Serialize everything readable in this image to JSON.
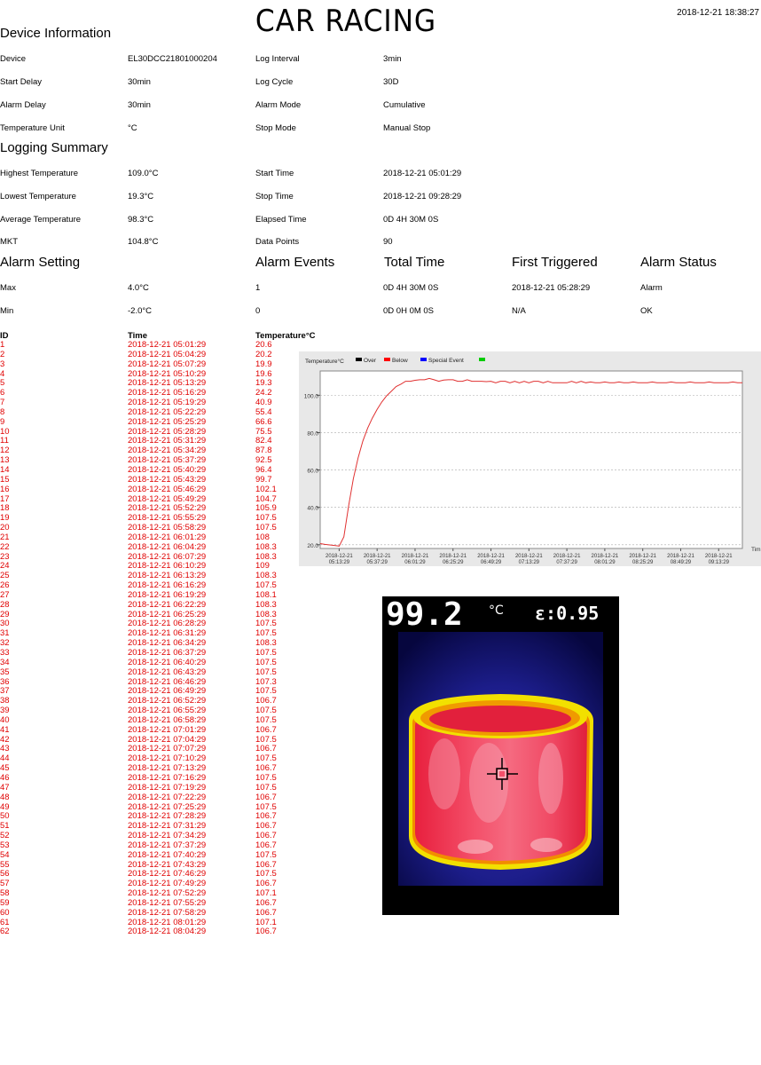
{
  "header": {
    "title": "CAR RACING",
    "timestamp": "2018-12-21 18:38:27"
  },
  "device_info": {
    "heading": "Device Information",
    "left": [
      {
        "label": "Device",
        "value": "EL30DCC21801000204"
      },
      {
        "label": "Start Delay",
        "value": "30min"
      },
      {
        "label": "Alarm Delay",
        "value": "30min"
      },
      {
        "label": "Temperature Unit",
        "value": "°C"
      }
    ],
    "right": [
      {
        "label": "Log Interval",
        "value": "3min"
      },
      {
        "label": "Log Cycle",
        "value": "30D"
      },
      {
        "label": "Alarm Mode",
        "value": "Cumulative"
      },
      {
        "label": "Stop Mode",
        "value": "Manual Stop"
      }
    ]
  },
  "summary": {
    "heading": "Logging Summary",
    "left": [
      {
        "label": "Highest Temperature",
        "value": "109.0°C"
      },
      {
        "label": "Lowest Temperature",
        "value": "19.3°C"
      },
      {
        "label": "Average Temperature",
        "value": "98.3°C"
      },
      {
        "label": "MKT",
        "value": "104.8°C"
      }
    ],
    "right": [
      {
        "label": "Start Time",
        "value": "2018-12-21 05:01:29"
      },
      {
        "label": "Stop Time",
        "value": "2018-12-21 09:28:29"
      },
      {
        "label": "Elapsed Time",
        "value": "0D 4H 30M 0S"
      },
      {
        "label": "Data Points",
        "value": "90"
      }
    ]
  },
  "alarm": {
    "headings": [
      "Alarm Setting",
      "Alarm Events",
      "Total Time",
      "First Triggered",
      "Alarm Status"
    ],
    "rows": [
      [
        "Max",
        "4.0°C",
        "1",
        "0D 4H 30M 0S",
        "2018-12-21 05:28:29",
        "Alarm"
      ],
      [
        "Min",
        "-2.0°C",
        "0",
        "0D 0H 0M 0S",
        "N/A",
        "OK"
      ]
    ]
  },
  "table": {
    "headers": [
      "ID",
      "Time",
      "Temperature°C"
    ],
    "rows": [
      [
        "1",
        "2018-12-21 05:01:29",
        "20.6"
      ],
      [
        "2",
        "2018-12-21 05:04:29",
        "20.2"
      ],
      [
        "3",
        "2018-12-21 05:07:29",
        "19.9"
      ],
      [
        "4",
        "2018-12-21 05:10:29",
        "19.6"
      ],
      [
        "5",
        "2018-12-21 05:13:29",
        "19.3"
      ],
      [
        "6",
        "2018-12-21 05:16:29",
        "24.2"
      ],
      [
        "7",
        "2018-12-21 05:19:29",
        "40.9"
      ],
      [
        "8",
        "2018-12-21 05:22:29",
        "55.4"
      ],
      [
        "9",
        "2018-12-21 05:25:29",
        "66.6"
      ],
      [
        "10",
        "2018-12-21 05:28:29",
        "75.5"
      ],
      [
        "11",
        "2018-12-21 05:31:29",
        "82.4"
      ],
      [
        "12",
        "2018-12-21 05:34:29",
        "87.8"
      ],
      [
        "13",
        "2018-12-21 05:37:29",
        "92.5"
      ],
      [
        "14",
        "2018-12-21 05:40:29",
        "96.4"
      ],
      [
        "15",
        "2018-12-21 05:43:29",
        "99.7"
      ],
      [
        "16",
        "2018-12-21 05:46:29",
        "102.1"
      ],
      [
        "17",
        "2018-12-21 05:49:29",
        "104.7"
      ],
      [
        "18",
        "2018-12-21 05:52:29",
        "105.9"
      ],
      [
        "19",
        "2018-12-21 05:55:29",
        "107.5"
      ],
      [
        "20",
        "2018-12-21 05:58:29",
        "107.5"
      ],
      [
        "21",
        "2018-12-21 06:01:29",
        "108"
      ],
      [
        "22",
        "2018-12-21 06:04:29",
        "108.3"
      ],
      [
        "23",
        "2018-12-21 06:07:29",
        "108.3"
      ],
      [
        "24",
        "2018-12-21 06:10:29",
        "109"
      ],
      [
        "25",
        "2018-12-21 06:13:29",
        "108.3"
      ],
      [
        "26",
        "2018-12-21 06:16:29",
        "107.5"
      ],
      [
        "27",
        "2018-12-21 06:19:29",
        "108.1"
      ],
      [
        "28",
        "2018-12-21 06:22:29",
        "108.3"
      ],
      [
        "29",
        "2018-12-21 06:25:29",
        "108.3"
      ],
      [
        "30",
        "2018-12-21 06:28:29",
        "107.5"
      ],
      [
        "31",
        "2018-12-21 06:31:29",
        "107.5"
      ],
      [
        "32",
        "2018-12-21 06:34:29",
        "108.3"
      ],
      [
        "33",
        "2018-12-21 06:37:29",
        "107.5"
      ],
      [
        "34",
        "2018-12-21 06:40:29",
        "107.5"
      ],
      [
        "35",
        "2018-12-21 06:43:29",
        "107.5"
      ],
      [
        "36",
        "2018-12-21 06:46:29",
        "107.3"
      ],
      [
        "37",
        "2018-12-21 06:49:29",
        "107.5"
      ],
      [
        "38",
        "2018-12-21 06:52:29",
        "106.7"
      ],
      [
        "39",
        "2018-12-21 06:55:29",
        "107.5"
      ],
      [
        "40",
        "2018-12-21 06:58:29",
        "107.5"
      ],
      [
        "41",
        "2018-12-21 07:01:29",
        "106.7"
      ],
      [
        "42",
        "2018-12-21 07:04:29",
        "107.5"
      ],
      [
        "43",
        "2018-12-21 07:07:29",
        "106.7"
      ],
      [
        "44",
        "2018-12-21 07:10:29",
        "107.5"
      ],
      [
        "45",
        "2018-12-21 07:13:29",
        "106.7"
      ],
      [
        "46",
        "2018-12-21 07:16:29",
        "107.5"
      ],
      [
        "47",
        "2018-12-21 07:19:29",
        "107.5"
      ],
      [
        "48",
        "2018-12-21 07:22:29",
        "106.7"
      ],
      [
        "49",
        "2018-12-21 07:25:29",
        "107.5"
      ],
      [
        "50",
        "2018-12-21 07:28:29",
        "106.7"
      ],
      [
        "51",
        "2018-12-21 07:31:29",
        "106.7"
      ],
      [
        "52",
        "2018-12-21 07:34:29",
        "106.7"
      ],
      [
        "53",
        "2018-12-21 07:37:29",
        "106.7"
      ],
      [
        "54",
        "2018-12-21 07:40:29",
        "107.5"
      ],
      [
        "55",
        "2018-12-21 07:43:29",
        "106.7"
      ],
      [
        "56",
        "2018-12-21 07:46:29",
        "107.5"
      ],
      [
        "57",
        "2018-12-21 07:49:29",
        "106.7"
      ],
      [
        "58",
        "2018-12-21 07:52:29",
        "107.1"
      ],
      [
        "59",
        "2018-12-21 07:55:29",
        "106.7"
      ],
      [
        "60",
        "2018-12-21 07:58:29",
        "106.7"
      ],
      [
        "61",
        "2018-12-21 08:01:29",
        "107.1"
      ],
      [
        "62",
        "2018-12-21 08:04:29",
        "106.7"
      ]
    ]
  },
  "chart_data": {
    "type": "line",
    "ylabel": "Temperature°C",
    "xlabel": "Tim",
    "legend": [
      "Over",
      "Below",
      "Special Event"
    ],
    "legend_colors": [
      "#000000",
      "#ff0000",
      "#0000ff",
      "#00cc00"
    ],
    "line_color": "#e03030",
    "ylim": [
      18,
      113
    ],
    "yticks": [
      "20.0",
      "40.0",
      "60.0",
      "80.0",
      "100.0"
    ],
    "xticks": [
      [
        "2018-12-21",
        "05:13:29"
      ],
      [
        "2018-12-21",
        "05:37:29"
      ],
      [
        "2018-12-21",
        "06:01:29"
      ],
      [
        "2018-12-21",
        "06:25:29"
      ],
      [
        "2018-12-21",
        "06:49:29"
      ],
      [
        "2018-12-21",
        "07:13:29"
      ],
      [
        "2018-12-21",
        "07:37:29"
      ],
      [
        "2018-12-21",
        "08:01:29"
      ],
      [
        "2018-12-21",
        "08:25:29"
      ],
      [
        "2018-12-21",
        "08:49:29"
      ],
      [
        "2018-12-21",
        "09:13:29"
      ]
    ],
    "x": [
      "05:01:29",
      "05:04:29",
      "05:07:29",
      "05:10:29",
      "05:13:29",
      "05:16:29",
      "05:19:29",
      "05:22:29",
      "05:25:29",
      "05:28:29",
      "05:31:29",
      "05:34:29",
      "05:37:29",
      "05:40:29",
      "05:43:29",
      "05:46:29",
      "05:49:29",
      "05:52:29",
      "05:55:29",
      "05:58:29",
      "06:01:29",
      "06:04:29",
      "06:07:29",
      "06:10:29",
      "06:13:29",
      "06:16:29",
      "06:19:29",
      "06:22:29",
      "06:25:29",
      "06:28:29",
      "06:31:29",
      "06:34:29",
      "06:37:29",
      "06:40:29",
      "06:43:29",
      "06:46:29",
      "06:49:29",
      "06:52:29",
      "06:55:29",
      "06:58:29",
      "07:01:29",
      "07:04:29",
      "07:07:29",
      "07:10:29",
      "07:13:29",
      "07:16:29",
      "07:19:29",
      "07:22:29",
      "07:25:29",
      "07:28:29",
      "07:31:29",
      "07:34:29",
      "07:37:29",
      "07:40:29",
      "07:43:29",
      "07:46:29",
      "07:49:29",
      "07:52:29",
      "07:55:29",
      "07:58:29",
      "08:01:29",
      "08:04:29",
      "08:07:29",
      "08:10:29",
      "08:13:29",
      "08:16:29",
      "08:19:29",
      "08:22:29",
      "08:25:29",
      "08:28:29",
      "08:31:29",
      "08:34:29",
      "08:37:29",
      "08:40:29",
      "08:43:29",
      "08:46:29",
      "08:49:29",
      "08:52:29",
      "08:55:29",
      "08:58:29",
      "09:01:29",
      "09:04:29",
      "09:07:29",
      "09:10:29",
      "09:13:29",
      "09:16:29",
      "09:19:29",
      "09:22:29",
      "09:25:29",
      "09:28:29"
    ],
    "values": [
      20.6,
      20.2,
      19.9,
      19.6,
      19.3,
      24.2,
      40.9,
      55.4,
      66.6,
      75.5,
      82.4,
      87.8,
      92.5,
      96.4,
      99.7,
      102.1,
      104.7,
      105.9,
      107.5,
      107.5,
      108,
      108.3,
      108.3,
      109,
      108.3,
      107.5,
      108.1,
      108.3,
      108.3,
      107.5,
      107.5,
      108.3,
      107.5,
      107.5,
      107.5,
      107.3,
      107.5,
      106.7,
      107.5,
      107.5,
      106.7,
      107.5,
      106.7,
      107.5,
      106.7,
      107.5,
      107.5,
      106.7,
      107.5,
      106.7,
      106.7,
      106.7,
      106.7,
      107.5,
      106.7,
      107.5,
      106.7,
      107.1,
      106.7,
      106.7,
      107.1,
      106.7,
      106.7,
      107.1,
      106.7,
      106.7,
      107.1,
      106.7,
      106.7,
      106.7,
      107.1,
      106.7,
      106.7,
      106.7,
      107.1,
      106.7,
      106.7,
      106.7,
      107.1,
      106.7,
      106.7,
      106.7,
      107.1,
      106.7,
      106.7,
      106.7,
      106.7,
      107.1,
      106.7,
      106.7
    ]
  },
  "thermal": {
    "reading": "99.2",
    "unit": "°C",
    "emissivity": "ε:0.95"
  }
}
